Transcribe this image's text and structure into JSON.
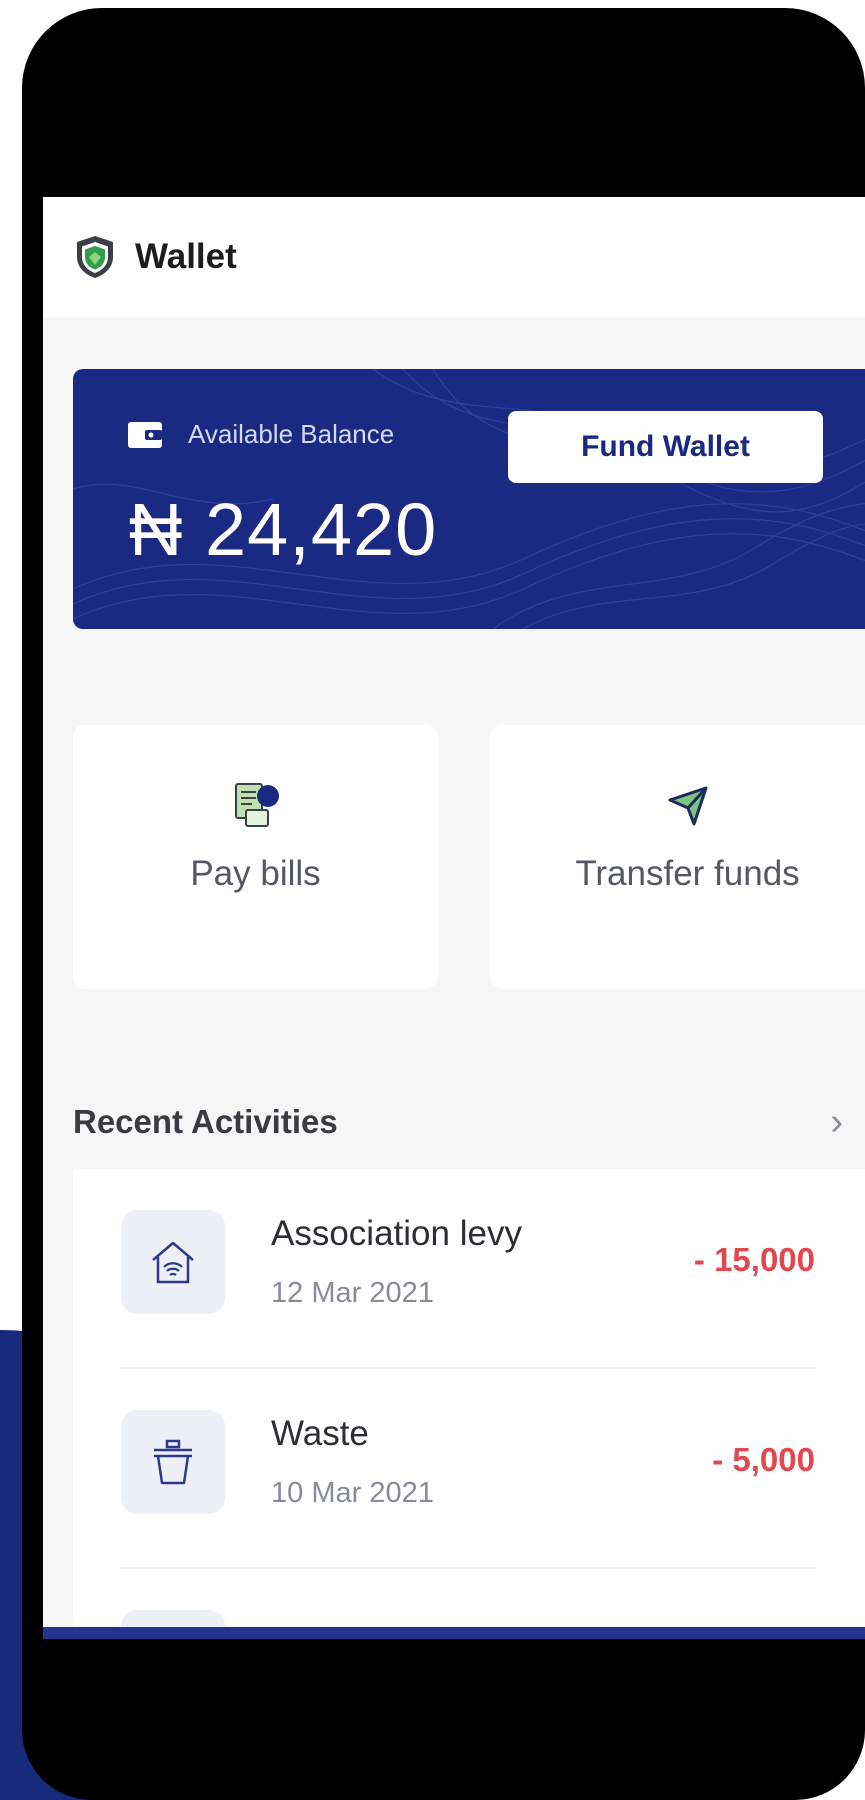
{
  "header": {
    "title": "Wallet"
  },
  "balance": {
    "label": "Available Balance",
    "amount": "₦ 24,420",
    "fund_button": "Fund Wallet"
  },
  "actions": [
    {
      "label": "Pay bills",
      "icon": "bill-receipt-icon"
    },
    {
      "label": "Transfer funds",
      "icon": "send-arrow-icon"
    }
  ],
  "recent": {
    "title": "Recent Activities",
    "items": [
      {
        "name": "Association levy",
        "date": "12 Mar 2021",
        "amount": "- 15,000",
        "icon": "house-wifi-icon"
      },
      {
        "name": "Waste",
        "date": "10 Mar 2021",
        "amount": "- 5,000",
        "icon": "trash-bin-icon"
      }
    ]
  },
  "colors": {
    "brand": "#1a2a82",
    "debit": "#e0474f",
    "background": "#f6f6f7"
  }
}
